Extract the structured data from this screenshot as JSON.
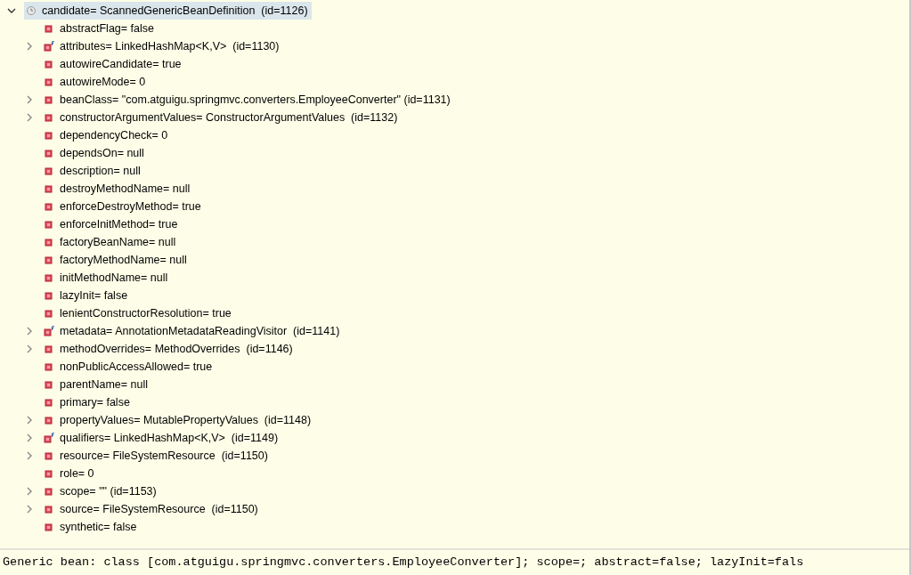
{
  "variables": {
    "root": {
      "label": "candidate= ScannedGenericBeanDefinition  (id=1126)",
      "kind": "local",
      "expanded": true,
      "selected": true
    },
    "children": [
      {
        "label": "abstractFlag= false",
        "kind": "field",
        "expandable": false
      },
      {
        "label": "attributes= LinkedHashMap<K,V>  (id=1130)",
        "kind": "final_field",
        "expandable": true
      },
      {
        "label": "autowireCandidate= true",
        "kind": "field",
        "expandable": false
      },
      {
        "label": "autowireMode= 0",
        "kind": "field",
        "expandable": false
      },
      {
        "label": "beanClass= \"com.atguigu.springmvc.converters.EmployeeConverter\" (id=1131)",
        "kind": "field",
        "expandable": true
      },
      {
        "label": "constructorArgumentValues= ConstructorArgumentValues  (id=1132)",
        "kind": "field",
        "expandable": true
      },
      {
        "label": "dependencyCheck= 0",
        "kind": "field",
        "expandable": false
      },
      {
        "label": "dependsOn= null",
        "kind": "field",
        "expandable": false
      },
      {
        "label": "description= null",
        "kind": "field",
        "expandable": false
      },
      {
        "label": "destroyMethodName= null",
        "kind": "field",
        "expandable": false
      },
      {
        "label": "enforceDestroyMethod= true",
        "kind": "field",
        "expandable": false
      },
      {
        "label": "enforceInitMethod= true",
        "kind": "field",
        "expandable": false
      },
      {
        "label": "factoryBeanName= null",
        "kind": "field",
        "expandable": false
      },
      {
        "label": "factoryMethodName= null",
        "kind": "field",
        "expandable": false
      },
      {
        "label": "initMethodName= null",
        "kind": "field",
        "expandable": false
      },
      {
        "label": "lazyInit= false",
        "kind": "field",
        "expandable": false
      },
      {
        "label": "lenientConstructorResolution= true",
        "kind": "field",
        "expandable": false
      },
      {
        "label": "metadata= AnnotationMetadataReadingVisitor  (id=1141)",
        "kind": "final_field",
        "expandable": true
      },
      {
        "label": "methodOverrides= MethodOverrides  (id=1146)",
        "kind": "field",
        "expandable": true
      },
      {
        "label": "nonPublicAccessAllowed= true",
        "kind": "field",
        "expandable": false
      },
      {
        "label": "parentName= null",
        "kind": "field",
        "expandable": false
      },
      {
        "label": "primary= false",
        "kind": "field",
        "expandable": false
      },
      {
        "label": "propertyValues= MutablePropertyValues  (id=1148)",
        "kind": "field",
        "expandable": true
      },
      {
        "label": "qualifiers= LinkedHashMap<K,V>  (id=1149)",
        "kind": "final_field",
        "expandable": true
      },
      {
        "label": "resource= FileSystemResource  (id=1150)",
        "kind": "field",
        "expandable": true
      },
      {
        "label": "role= 0",
        "kind": "field",
        "expandable": false
      },
      {
        "label": "scope= \"\" (id=1153)",
        "kind": "field",
        "expandable": true
      },
      {
        "label": "source= FileSystemResource  (id=1150)",
        "kind": "field",
        "expandable": true
      },
      {
        "label": "synthetic= false",
        "kind": "field",
        "expandable": false
      }
    ]
  },
  "detail": "Generic bean: class [com.atguigu.springmvc.converters.EmployeeConverter]; scope=; abstract=false; lazyInit=fals"
}
